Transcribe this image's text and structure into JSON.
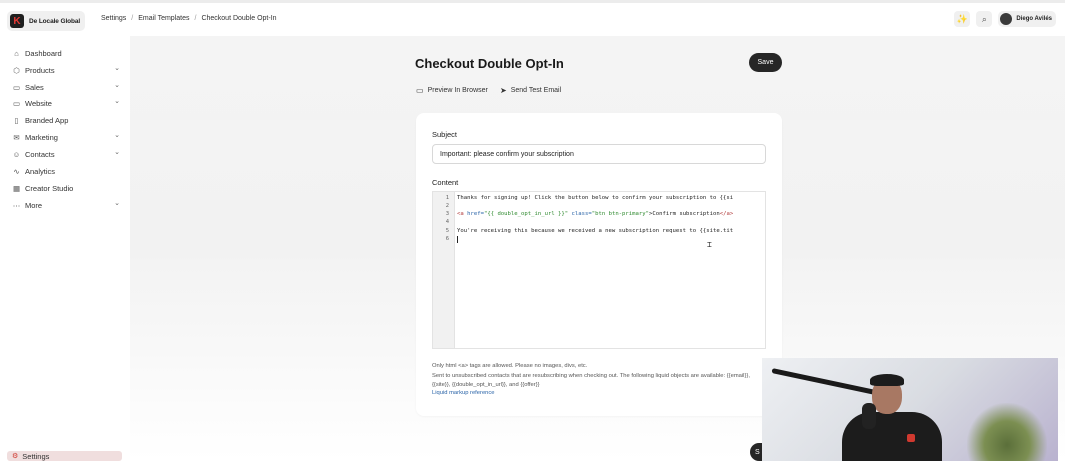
{
  "header": {
    "brand_name": "De Locale Global",
    "brand_logo_letter": "K",
    "breadcrumb": [
      "Settings",
      "Email Templates",
      "Checkout Double Opt-In"
    ],
    "user_name": "Diego Avilés"
  },
  "sidebar": {
    "items": [
      {
        "label": "Dashboard",
        "icon": "home-icon",
        "has_chevron": false
      },
      {
        "label": "Products",
        "icon": "box-icon",
        "has_chevron": true
      },
      {
        "label": "Sales",
        "icon": "card-icon",
        "has_chevron": true
      },
      {
        "label": "Website",
        "icon": "monitor-icon",
        "has_chevron": true
      },
      {
        "label": "Branded App",
        "icon": "phone-icon",
        "has_chevron": false
      },
      {
        "label": "Marketing",
        "icon": "mail-icon",
        "has_chevron": true
      },
      {
        "label": "Contacts",
        "icon": "users-icon",
        "has_chevron": true
      },
      {
        "label": "Analytics",
        "icon": "chart-icon",
        "has_chevron": false
      },
      {
        "label": "Creator Studio",
        "icon": "calendar-icon",
        "has_chevron": false
      },
      {
        "label": "More",
        "icon": "more-icon",
        "has_chevron": true
      }
    ],
    "settings_label": "Settings"
  },
  "page": {
    "title": "Checkout Double Opt-In",
    "save_label": "Save",
    "preview_label": "Preview In Browser",
    "send_test_label": "Send Test Email"
  },
  "form": {
    "subject_label": "Subject",
    "subject_value": "Important: please confirm your subscription",
    "content_label": "Content",
    "line_numbers": [
      "1",
      "2",
      "3",
      "4",
      "5",
      "6"
    ],
    "code_line_1": "Thanks for signing up! Click the button below to confirm your subscription to {{si",
    "code_line_3_a": "<a",
    "code_line_3_b": " href=",
    "code_line_3_c": "\"{{ double_opt_in_url }}\"",
    "code_line_3_d": " class=",
    "code_line_3_e": "\"btn btn-primary\"",
    "code_line_3_f": ">Confirm subscription",
    "code_line_3_g": "</a>",
    "code_line_5": "You're receiving this because we received a new subscription request to {{site.tit",
    "help_line_1": "Only html <a> tags are allowed. Please no images, divs, etc.",
    "help_line_2": "Sent to unsubscribed contacts that are resubscribing when checking out. The following liquid objects are available: {{email}}, {{site}}, {{double_opt_in_url}}, and {{offer}}",
    "help_link": "Liquid markup reference"
  },
  "colors": {
    "accent_dark": "#262626",
    "brand_red": "#e53935",
    "link_blue": "#2a64a8"
  }
}
